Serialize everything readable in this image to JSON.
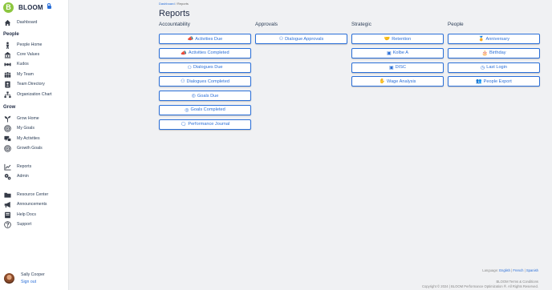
{
  "brand": {
    "name": "BLOOM",
    "logo_letter": "B"
  },
  "sidebar": {
    "dashboard": "Dashboard",
    "sections": {
      "people": "People",
      "grow": "Grow"
    },
    "people_items": [
      "People Home",
      "Core Values",
      "Kudos",
      "My Team",
      "Team Directory",
      "Organization Chart"
    ],
    "grow_items": [
      "Grow Home",
      "My Goals",
      "My Activities",
      "Growth Goals"
    ],
    "misc_items": [
      "Reports",
      "Admin"
    ],
    "resource_items": [
      "Resource Center",
      "Announcements",
      "Help Docs",
      "Support"
    ],
    "icons": {
      "dashboard": "home-icon",
      "people_home": "person-icon",
      "core_values": "values-icon",
      "kudos": "kudos-icon",
      "my_team": "team-icon",
      "team_directory": "directory-icon",
      "org_chart": "org-chart-icon",
      "grow_home": "sprout-icon",
      "my_goals": "target-icon",
      "my_activities": "activities-icon",
      "growth_goals": "bullseye-icon",
      "reports": "chart-icon",
      "admin": "gears-icon",
      "resource_center": "folder-icon",
      "announcements": "megaphone-icon",
      "help_docs": "book-icon",
      "support": "question-icon"
    }
  },
  "user": {
    "name": "Sally Cooper",
    "sign_out": "Sign out"
  },
  "breadcrumb": {
    "parent": "Dashboard",
    "separator": " / ",
    "current": "Reports"
  },
  "page_title": "Reports",
  "columns": [
    {
      "heading": "Accountability",
      "buttons": [
        "Activities Due",
        "Activities Completed",
        "Dialogues Due",
        "Dialogues Completed",
        "Goals Due",
        "Goals Completed",
        "Performance Journal"
      ]
    },
    {
      "heading": "Approvals",
      "buttons": [
        "Dialogue Approvals"
      ]
    },
    {
      "heading": "Strategic",
      "buttons": [
        "Retention",
        "Kolbe A",
        "DISC",
        "Wage Analysis"
      ]
    },
    {
      "heading": "People",
      "buttons": [
        "Anniversary",
        "Birthday",
        "Last Login",
        "People Export"
      ]
    }
  ],
  "footer": {
    "language_label": "Language:",
    "languages": [
      "English",
      "French",
      "Spanish"
    ],
    "terms": "BLOOM Terms & Conditions",
    "copyright": "Copyright © 2024 | BLOOM Performance Optimization ®. All Rights Reserved."
  },
  "colors": {
    "accent": "#2a6fd8",
    "logo_green": "#8cc63f",
    "sidebar_bg": "#ffffff",
    "page_bg": "#f0f1f3"
  }
}
